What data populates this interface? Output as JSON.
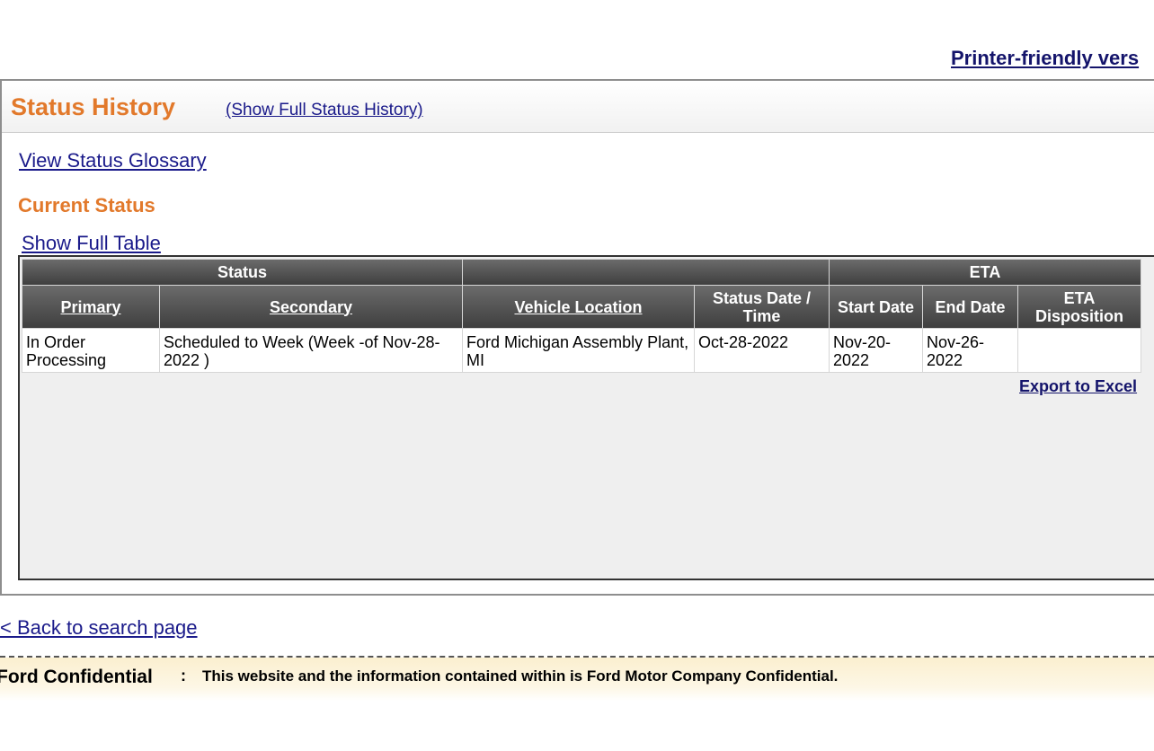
{
  "printer_link": "Printer-friendly vers",
  "panel": {
    "title": "Status History",
    "show_full_history": "(Show Full Status History)"
  },
  "glossary_link": "View Status Glossary",
  "current_status_heading": "Current Status",
  "show_full_table": "Show Full Table",
  "table": {
    "group_headers": {
      "status": "Status",
      "blank": "",
      "eta": "ETA"
    },
    "columns": {
      "primary": "Primary",
      "secondary": "Secondary",
      "vehicle_location": "Vehicle Location",
      "status_date_time": "Status Date / Time",
      "start_date": "Start Date",
      "end_date": "End Date",
      "eta_disposition": "ETA Disposition"
    },
    "rows": [
      {
        "primary": "In Order Processing",
        "secondary": "Scheduled to Week (Week -of Nov-28-2022 )",
        "vehicle_location": "Ford Michigan Assembly Plant, MI",
        "status_date_time": "Oct-28-2022",
        "start_date": "Nov-20-2022",
        "end_date": "Nov-26-2022",
        "eta_disposition": ""
      }
    ],
    "export_link": "Export to Excel"
  },
  "back_link": "< Back to search page",
  "footer": {
    "title": "Ford Confidential",
    "colon": ":",
    "text": "This website and the information contained within is Ford Motor Company Confidential."
  },
  "colors": {
    "accent_orange": "#e2792b",
    "link_blue": "#1a1a8a",
    "header_gray": "#4f4f4f",
    "footer_bg": "#fbefcf"
  }
}
